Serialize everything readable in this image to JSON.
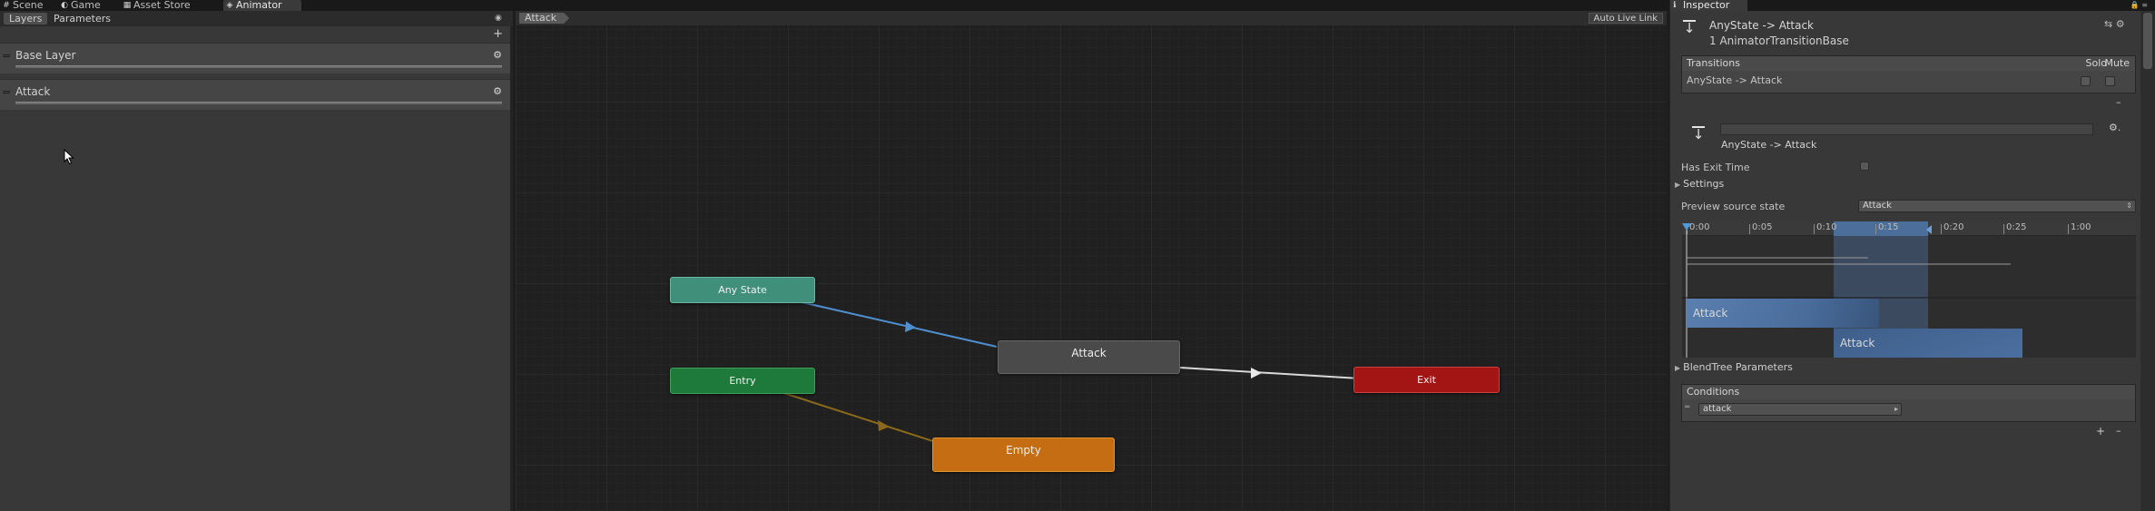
{
  "top_tabs": [
    {
      "label": "Scene",
      "icon": "scene-icon",
      "glyph": "#"
    },
    {
      "label": "Game",
      "icon": "game-icon",
      "glyph": "◐"
    },
    {
      "label": "Asset Store",
      "icon": "asset-store-icon",
      "glyph": "▦"
    },
    {
      "label": "Animator",
      "icon": "animator-icon",
      "glyph": "◈"
    }
  ],
  "left_panel": {
    "tabs": [
      "Layers",
      "Parameters"
    ],
    "add_symbol": "+",
    "layers": [
      {
        "name": "Base Layer",
        "gear": "⚙"
      },
      {
        "name": "Attack",
        "gear": "⚙"
      }
    ]
  },
  "graph": {
    "breadcrumb": "Attack",
    "auto_live_link": "Auto Live Link",
    "nodes": {
      "any_state": {
        "label": "Any State",
        "color": "#3f8f7a"
      },
      "entry": {
        "label": "Entry",
        "color": "#1e7a3a"
      },
      "attack": {
        "label": "Attack",
        "color": "#4a4a4a"
      },
      "exit": {
        "label": "Exit",
        "color": "#a31515"
      },
      "empty": {
        "label": "Empty",
        "color": "#c46d12"
      }
    },
    "link_colors": {
      "any_state": "#4f8fd0",
      "entry": "#8a6a1a",
      "exit": "#d8d8d8"
    }
  },
  "inspector": {
    "tab": "Inspector",
    "title": "AnyState -> Attack",
    "subtitle": "1 AnimatorTransitionBase",
    "transitions": {
      "header": "Transitions",
      "solo": "Solo",
      "mute": "Mute",
      "row": "AnyState -> Attack",
      "remove": "–"
    },
    "transition_name": "AnyState -> Attack",
    "has_exit_time": "Has Exit Time",
    "settings": "Settings",
    "preview_source_state_label": "Preview source state",
    "preview_source_state_value": "Attack",
    "timeline": {
      "ticks": [
        "0:00",
        "0:05",
        "0:10",
        "0:15",
        "0:20",
        "0:25",
        "1:00"
      ],
      "clips": [
        "Attack",
        "Attack"
      ]
    },
    "blendtree_parameters": "BlendTree Parameters",
    "conditions": {
      "header": "Conditions",
      "items": [
        "attack"
      ],
      "add": "+",
      "remove": "–"
    }
  }
}
